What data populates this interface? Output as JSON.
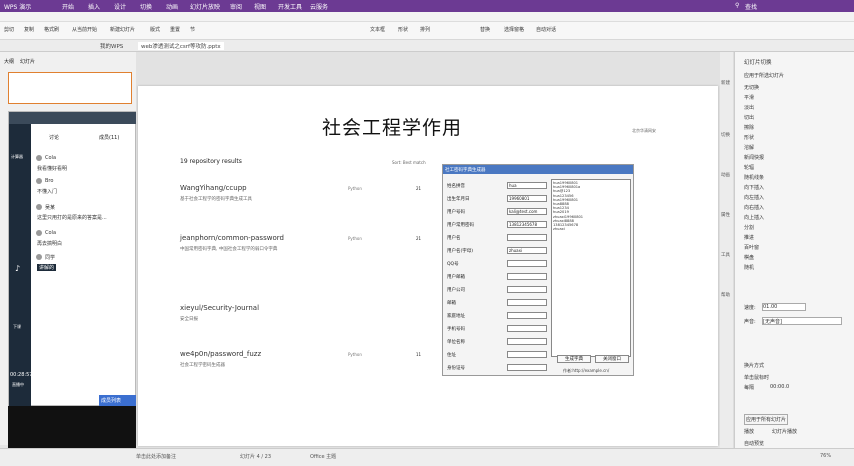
{
  "titlebar": {
    "app": "WPS 演示",
    "tabs": [
      "开始",
      "插入",
      "设计",
      "切换",
      "动画",
      "幻灯片放映",
      "审阅",
      "视图",
      "开发工具",
      "云服务"
    ],
    "search": "查找"
  },
  "ribbon": {
    "items": [
      "剪切",
      "复制",
      "格式刷",
      "从当前开始",
      "新建幻灯片",
      "版式",
      "重置",
      "节",
      "文本框",
      "形状",
      "排列",
      "替换",
      "选择窗格",
      "自动对话"
    ]
  },
  "doctabs": {
    "tabs": [
      "我的WPS",
      "web渗透测试之csrf等攻防.pptx"
    ]
  },
  "left": {
    "tabs": [
      "大纲",
      "幻灯片"
    ]
  },
  "chat": {
    "tabs": [
      "讨论",
      "成员(11)"
    ],
    "side": [
      "计算器",
      "下课"
    ],
    "messages": [
      "我看懂好看明",
      "不懂入门",
      "这里只用打的是原来的答案是...",
      "再去搞明白",
      "讲解的"
    ],
    "names": [
      "Cola",
      "Bro",
      "吴某",
      "Cola",
      "同学"
    ],
    "time": "00:28:57",
    "live": "直播中",
    "footer": "成员列表"
  },
  "slide": {
    "title": "社会工程学作用",
    "logo": "北京华清网安"
  },
  "repo": {
    "count": "19 repository results",
    "sort": "Sort: Best match",
    "items": [
      {
        "name": "WangYihang/ccupp",
        "desc": "基于社会工程学的密码字典生成工具",
        "lang": "Python",
        "stars": "21"
      },
      {
        "name": "jeanphorn/common-password",
        "desc": "中国常用密码字典, 中国社会工程学的弱口令字典",
        "lang": "Python",
        "stars": "21"
      },
      {
        "name": "xieyul/Security-Journal",
        "desc": "安全日报",
        "lang": "",
        "stars": ""
      },
      {
        "name": "we4p0n/password_fuzz",
        "desc": "社会工程学密码生成器",
        "lang": "Python",
        "stars": "11"
      }
    ]
  },
  "dialog": {
    "title": "社工密码字典生成器",
    "fields": [
      "姓名拼音",
      "出生年月日",
      "用户号码",
      "用户常用密码",
      "用户名",
      "用户名(字母)",
      "QQ号",
      "用户邮箱",
      "用户公司",
      "邮箱",
      "家庭地址",
      "手机号码",
      "单位名称",
      "住址",
      "身份证号",
      "部门",
      "身份证号码"
    ],
    "values": [
      "hua",
      "19960801",
      "kali@test.com",
      "13812345678",
      "",
      "zhuaxi"
    ],
    "output": [
      "hua19960801",
      "hua19960801a",
      "hua@123",
      "hua123456",
      "hua19960801",
      "hua8888",
      "hua1234",
      "hua2019",
      "zhuaxi19960801",
      "zhuaxi8888",
      "13812345678",
      "zhuaxi"
    ],
    "btn_generate": "生成字典",
    "btn_clear": "关闭窗口",
    "note": "作者:http://example.cn/"
  },
  "rpanel": {
    "title": "幻灯片切换",
    "items": [
      "应用于所选幻灯片",
      "无切换",
      "平滑",
      "淡出",
      "切出",
      "擦除",
      "形状",
      "溶解",
      "新闻快报",
      "轮辐",
      "随机线条",
      "向下插入",
      "向左插入",
      "向右插入",
      "向上插入",
      "分割",
      "推进",
      "百叶窗",
      "棋盘",
      "随机"
    ],
    "speed_label": "速度:",
    "speed": "01.00",
    "sound_label": "声音:",
    "sound": "[无声音]",
    "mode": "换片方式",
    "click": "单击鼠标时",
    "every": "每隔",
    "every_val": "00:00.0",
    "apply_all": "应用于所有幻灯片",
    "play": "播放",
    "slideshow": "幻灯片播放",
    "auto": "自动预览"
  },
  "ricons": [
    "新建",
    "切换",
    "动画",
    "属性",
    "工具",
    "帮助"
  ],
  "statusbar": {
    "notes": "单击此处添加备注",
    "slide": "幻灯片 4 / 23",
    "theme": "Office 主题",
    "zoom": "76%"
  }
}
